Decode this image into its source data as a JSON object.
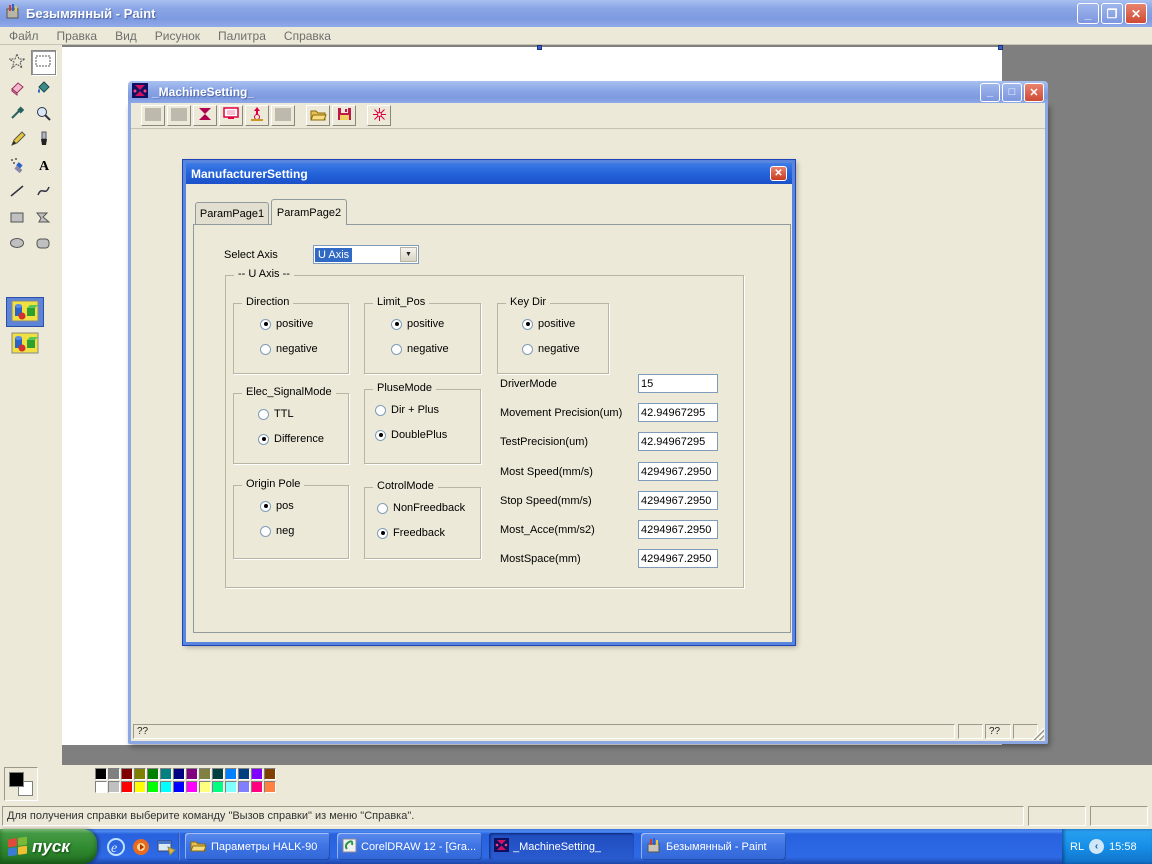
{
  "paint": {
    "title": "Безымянный - Paint",
    "menu": [
      "Файл",
      "Правка",
      "Вид",
      "Рисунок",
      "Палитра",
      "Справка"
    ],
    "tools": [
      {
        "name": "free-form-select",
        "selected": false
      },
      {
        "name": "select",
        "selected": true
      },
      {
        "name": "eraser",
        "selected": false
      },
      {
        "name": "fill",
        "selected": false
      },
      {
        "name": "color-picker",
        "selected": false
      },
      {
        "name": "magnifier",
        "selected": false
      },
      {
        "name": "pencil",
        "selected": false
      },
      {
        "name": "brush",
        "selected": false
      },
      {
        "name": "airbrush",
        "selected": false
      },
      {
        "name": "text",
        "selected": false
      },
      {
        "name": "line",
        "selected": false
      },
      {
        "name": "curve",
        "selected": false
      },
      {
        "name": "rectangle",
        "selected": false
      },
      {
        "name": "polygon",
        "selected": false
      },
      {
        "name": "ellipse",
        "selected": false
      },
      {
        "name": "rounded-rectangle",
        "selected": false
      }
    ],
    "tool_options": [
      {
        "name": "selection-option-1",
        "selected": true
      },
      {
        "name": "selection-option-2",
        "selected": false
      }
    ],
    "foreground_color": "#000000",
    "background_color": "#FFFFFF",
    "palette_row1": [
      "#000000",
      "#808080",
      "#800000",
      "#808000",
      "#008000",
      "#008080",
      "#000080",
      "#800080",
      "#808040",
      "#004040",
      "#0080FF",
      "#004080",
      "#8000FF",
      "#804000"
    ],
    "palette_row2": [
      "#FFFFFF",
      "#C0C0C0",
      "#FF0000",
      "#FFFF00",
      "#00FF00",
      "#00FFFF",
      "#0000FF",
      "#FF00FF",
      "#FFFF80",
      "#00FF80",
      "#80FFFF",
      "#8080FF",
      "#FF0080",
      "#FF8040"
    ],
    "status_text": "Для получения справки выберите команду \"Вызов справки\" из меню \"Справка\"."
  },
  "machine_window": {
    "title": "_MachineSetting_",
    "toolbar_icons": [
      "blank",
      "blank",
      "transform",
      "monitor",
      "axis-home",
      "blank",
      "open-folder",
      "save",
      "origin-star"
    ],
    "status_left": "??",
    "status_mid": "??"
  },
  "dialog": {
    "title": "ManufacturerSetting",
    "close_label": "✕",
    "tabs": [
      {
        "label": "ParamPage1",
        "active": false
      },
      {
        "label": "ParamPage2",
        "active": true
      }
    ],
    "select_axis_label": "Select Axis",
    "select_axis_value": "U Axis",
    "axis_group_title": "-- U Axis --",
    "radio_groups": [
      {
        "title": "Direction",
        "options": [
          "positive",
          "negative"
        ],
        "checked": 0,
        "indent": 26
      },
      {
        "title": "Limit_Pos",
        "options": [
          "positive",
          "negative"
        ],
        "checked": 0,
        "indent": 26
      },
      {
        "title": "Key Dir",
        "options": [
          "positive",
          "negative"
        ],
        "checked": 0,
        "indent": 24
      },
      {
        "title": "Elec_SignalMode",
        "options": [
          "TTL",
          "Difference"
        ],
        "checked": 1,
        "indent": 24
      },
      {
        "title": "PluseMode",
        "options": [
          "Dir + Plus",
          "DoublePlus"
        ],
        "checked": 1,
        "indent": 10
      },
      {
        "title": "Origin Pole",
        "options": [
          "pos",
          "neg"
        ],
        "checked": 0,
        "indent": 26
      },
      {
        "title": "CotrolMode",
        "options": [
          "NonFreedback",
          "Freedback"
        ],
        "checked": 1,
        "indent": 12
      }
    ],
    "fields": [
      {
        "label": "DriverMode",
        "value": "15"
      },
      {
        "label": "Movement Precision(um)",
        "value": "42.94967295"
      },
      {
        "label": "TestPrecision(um)",
        "value": "42.94967295"
      },
      {
        "label": "Most Speed(mm/s)",
        "value": "4294967.2950"
      },
      {
        "label": "Stop Speed(mm/s)",
        "value": "4294967.2950"
      },
      {
        "label": "Most_Acce(mm/s2)",
        "value": "4294967.2950"
      },
      {
        "label": "MostSpace(mm)",
        "value": "4294967.2950"
      }
    ]
  },
  "taskbar": {
    "start_label": "пуск",
    "quick_launch": [
      "internet-explorer-icon",
      "media-player-icon",
      "show-desktop-icon"
    ],
    "tasks": [
      {
        "label": "Параметры HALK-90",
        "icon": "folder",
        "active": false
      },
      {
        "label": "CorelDRAW 12 - [Gra...",
        "icon": "coreldraw",
        "active": false
      },
      {
        "label": "_MachineSetting_",
        "icon": "machine",
        "active": true
      },
      {
        "label": "Безымянный - Paint",
        "icon": "paint",
        "active": false
      }
    ],
    "tray": {
      "lang": "RL",
      "collapse_icon": "chevron-left",
      "time": "15:58"
    }
  },
  "colors": {
    "titlebar_inactive": "#8BA7E6",
    "titlebar_active": "#2363DA",
    "selection_blue": "#316AC5",
    "taskbar_blue": "#2E6AE6",
    "start_green": "#2F8A2F",
    "workspace_gray": "#7F7F7F",
    "chrome_beige": "#ECE9D8"
  }
}
